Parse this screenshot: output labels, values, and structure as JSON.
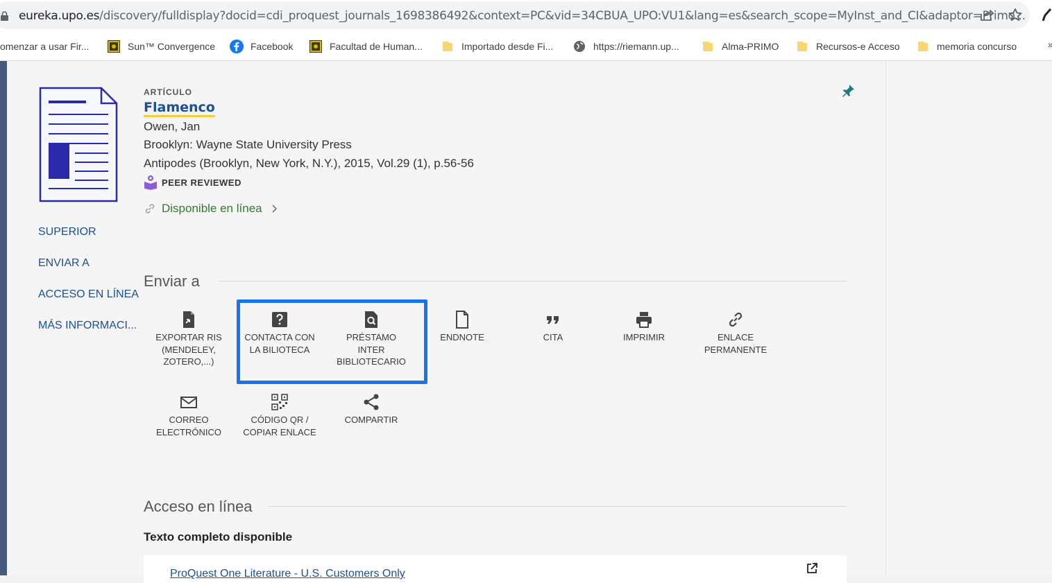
{
  "browser": {
    "url_domain": "eureka.upo.es",
    "url_rest": "/discovery/fulldisplay?docid=cdi_proquest_journals_1698386492&context=PC&vid=34CBUA_UPO:VU1&lang=es&search_scope=MyInst_and_CI&adaptor=Primo...",
    "bookmarks": [
      {
        "label": "omenzar a usar Fir...",
        "icon": "firefox-icon"
      },
      {
        "label": "Sun™ Convergence",
        "icon": "sun-convergence-icon"
      },
      {
        "label": "Facebook",
        "icon": "facebook-icon"
      },
      {
        "label": "Facultad de Human...",
        "icon": "faculty-icon"
      },
      {
        "label": "Importado desde Fi...",
        "icon": "folder-icon"
      },
      {
        "label": "https://riemann.up...",
        "icon": "globe-icon"
      },
      {
        "label": "Alma-PRIMO",
        "icon": "folder-icon"
      },
      {
        "label": "Recursos-e Acceso",
        "icon": "folder-icon"
      },
      {
        "label": "memoria concurso",
        "icon": "folder-icon"
      }
    ],
    "bookmarks_more": "»"
  },
  "sidenav": {
    "items": [
      "SUPERIOR",
      "ENVIAR A",
      "ACCESO EN LÍNEA",
      "MÁS INFORMACI..."
    ]
  },
  "record": {
    "type": "ARTÍCULO",
    "title": "Flamenco",
    "author": "Owen, Jan",
    "publisher": "Brooklyn: Wayne State University Press",
    "source": "Antipodes (Brooklyn, New York, N.Y.), 2015, Vol.29 (1), p.56-56",
    "peer_reviewed": "PEER REVIEWED",
    "availability": "Disponible en línea"
  },
  "send_to": {
    "heading": "Enviar a",
    "actions": [
      {
        "label": "Exportar RIS (Mendeley, Zotero,...)",
        "icon": "export-file-icon"
      },
      {
        "label": "Contacta con la biliotECA",
        "icon": "question-icon"
      },
      {
        "label": "Préstamo inter bibliotecario",
        "icon": "file-search-icon"
      },
      {
        "label": "EndNote",
        "icon": "file-icon"
      },
      {
        "label": "Cita",
        "icon": "quote-icon"
      },
      {
        "label": "Imprimir",
        "icon": "printer-icon"
      },
      {
        "label": "Enlace permanente",
        "icon": "link-icon"
      },
      {
        "label": "Correo electrónico",
        "icon": "envelope-icon"
      },
      {
        "label": "Código QR / copiar enlace",
        "icon": "qr-code-icon"
      },
      {
        "label": "Compartir",
        "icon": "share-icon"
      }
    ]
  },
  "online_access": {
    "heading": "Acceso en línea",
    "fulltext_label": "Texto completo disponible",
    "provider": "ProQuest One Literature - U.S. Customers Only"
  },
  "colors": {
    "accent_link": "#1b4f99",
    "available_green": "#2e7d32",
    "highlight_blue": "#1a73e8",
    "title_underline": "#f4cf3a",
    "pin_teal": "#1f7a7a"
  }
}
